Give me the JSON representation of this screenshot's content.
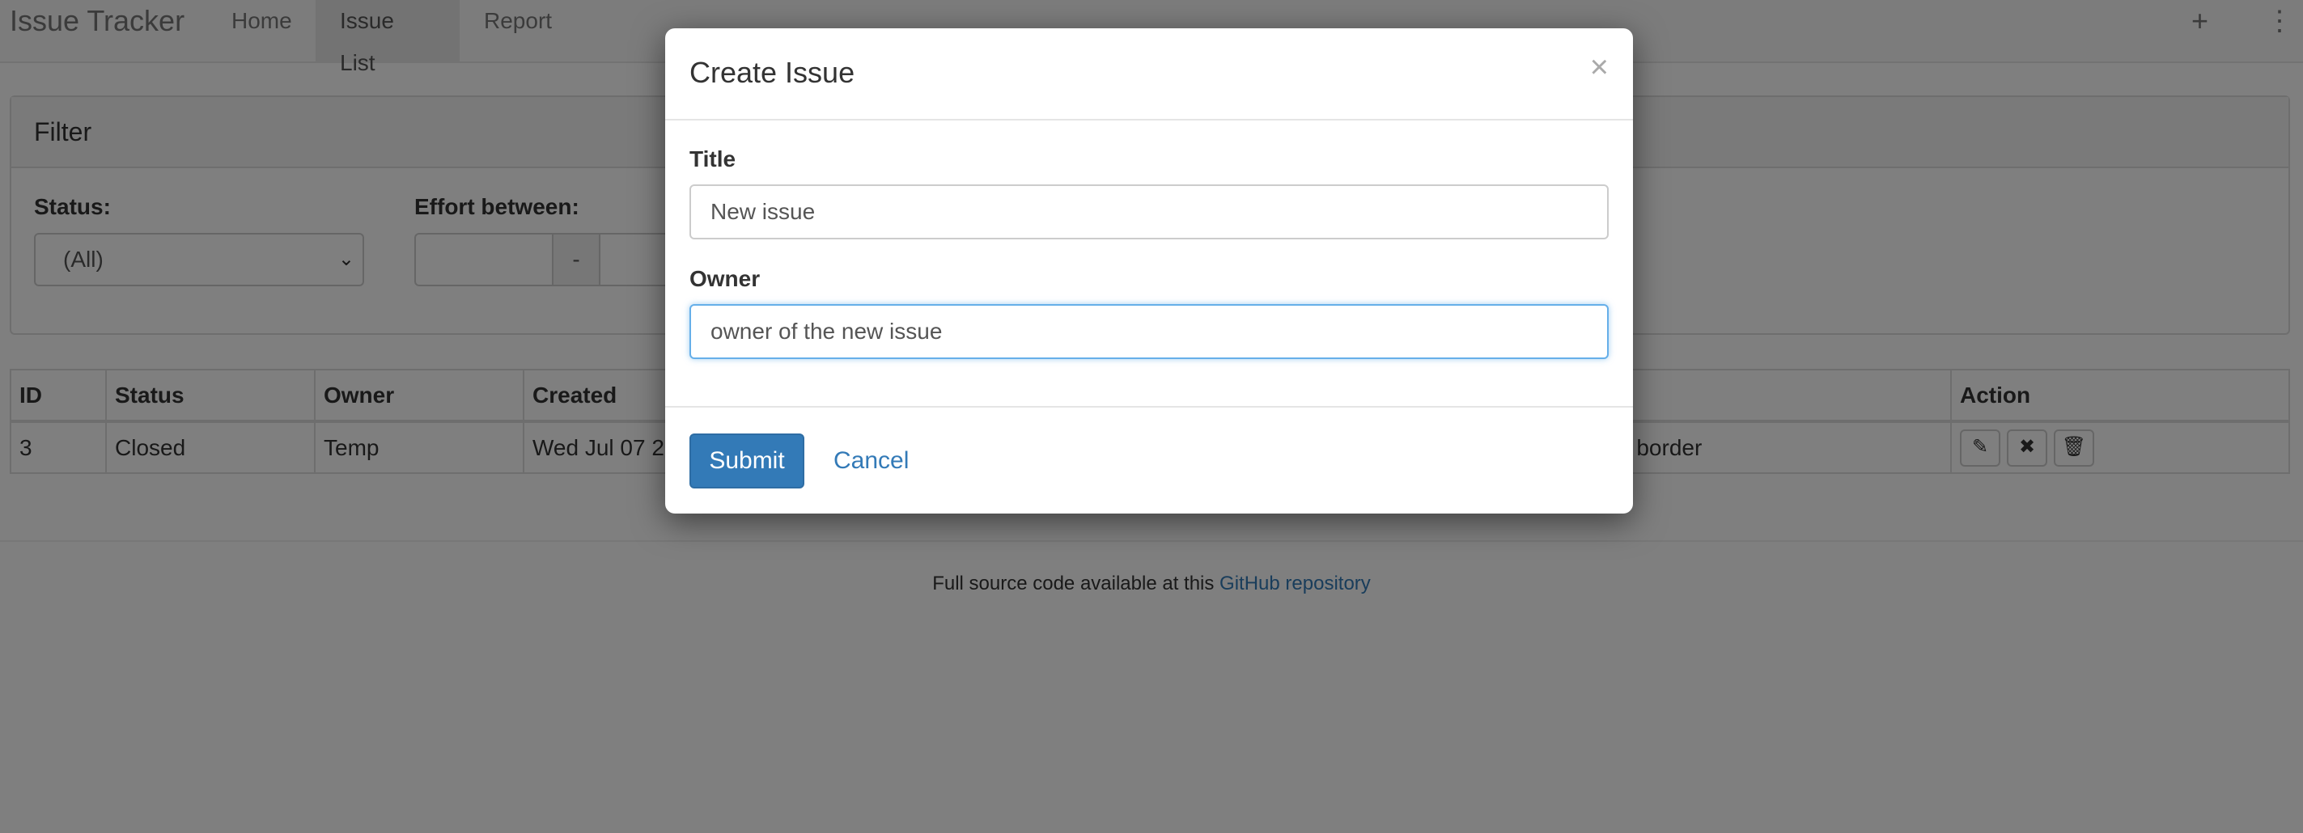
{
  "navbar": {
    "brand": "Issue Tracker",
    "links": [
      {
        "label": "Home",
        "active": false
      },
      {
        "label": "Issue List",
        "active": true
      },
      {
        "label": "Report",
        "active": false
      }
    ],
    "plus_icon": "+",
    "menu_icon": "⋮"
  },
  "filter": {
    "heading": "Filter",
    "status_label": "Status:",
    "status_value": "(All)",
    "effort_label": "Effort between:",
    "effort_separator": "-"
  },
  "table": {
    "headers": {
      "id": "ID",
      "status": "Status",
      "owner": "Owner",
      "created": "Created",
      "action": "Action"
    },
    "rows": [
      {
        "id": "3",
        "status": "Closed",
        "owner": "Temp",
        "created": "Wed Jul 07 20",
        "title": "g border"
      }
    ]
  },
  "footer": {
    "text": "Full source code available at this ",
    "link": "GitHub repository"
  },
  "modal": {
    "title": "Create Issue",
    "close": "×",
    "title_label": "Title",
    "title_value": "New issue",
    "owner_label": "Owner",
    "owner_value": "owner of the new issue",
    "submit_label": "Submit",
    "cancel_label": "Cancel"
  },
  "colors": {
    "primary": "#337ab7",
    "backdrop": "rgba(0,0,0,0.5)",
    "focus_ring": "#66afe9"
  }
}
